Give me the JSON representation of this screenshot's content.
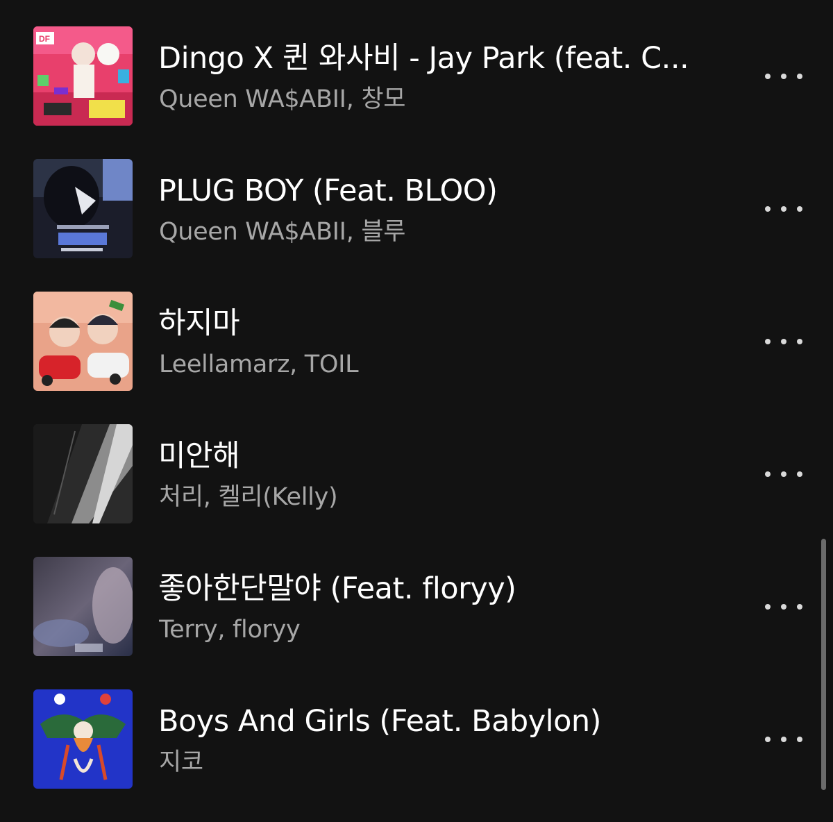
{
  "tracks": [
    {
      "title": "Dingo X 퀸 와사비 - Jay Park (feat. C...",
      "artist": "Queen WA$ABII, 창모",
      "cover": "pink collage album art"
    },
    {
      "title": "PLUG BOY (Feat. BLOO)",
      "artist": "Queen WA$ABII, 블루",
      "cover": "dark blue silhouette album art"
    },
    {
      "title": "하지마",
      "artist": "Leellamarz, TOIL",
      "cover": "3D cartoon characters in car album art"
    },
    {
      "title": "미안해",
      "artist": "처리, 켈리(Kelly)",
      "cover": "black and white abstract album art"
    },
    {
      "title": "좋아한단말야 (Feat. floryy)",
      "artist": "Terry, floryy",
      "cover": "blurred hand photo album art"
    },
    {
      "title": "Boys And Girls (Feat. Babylon)",
      "artist": "지코",
      "cover": "blue illustrated figure album art"
    }
  ],
  "more_icon": "more-horizontal-icon",
  "colors": {
    "background": "#121212",
    "title": "#ffffff",
    "artist": "#a7a7a7",
    "dots": "#d9d9d9"
  }
}
